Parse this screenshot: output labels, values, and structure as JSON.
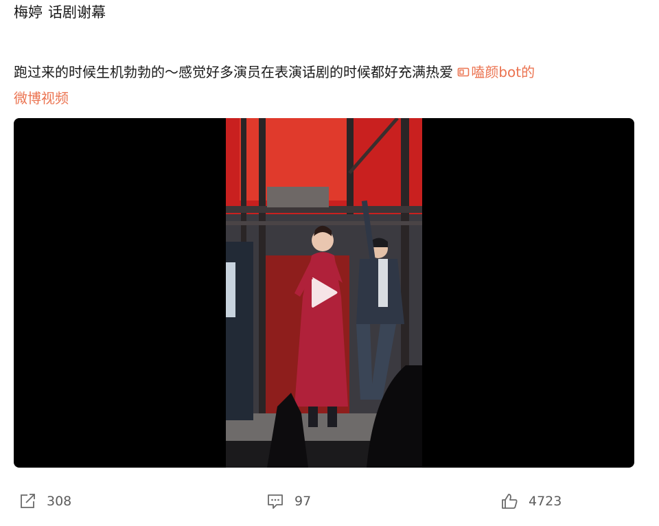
{
  "post": {
    "author": "梅婷",
    "title": "话剧谢幕",
    "text": "跑过来的时候生机勃勃的～感觉好多演员在表演话剧的时候都好充满热爱",
    "link_label": "嗑颜bot的",
    "link_suffix": "微博视频",
    "link_color": "#eb7350"
  },
  "video": {
    "play_icon": "play-icon",
    "dress_color": "#b0213a",
    "backdrop_color": "#c9201f"
  },
  "actions": {
    "repost_count": "308",
    "comment_count": "97",
    "like_count": "4723"
  }
}
